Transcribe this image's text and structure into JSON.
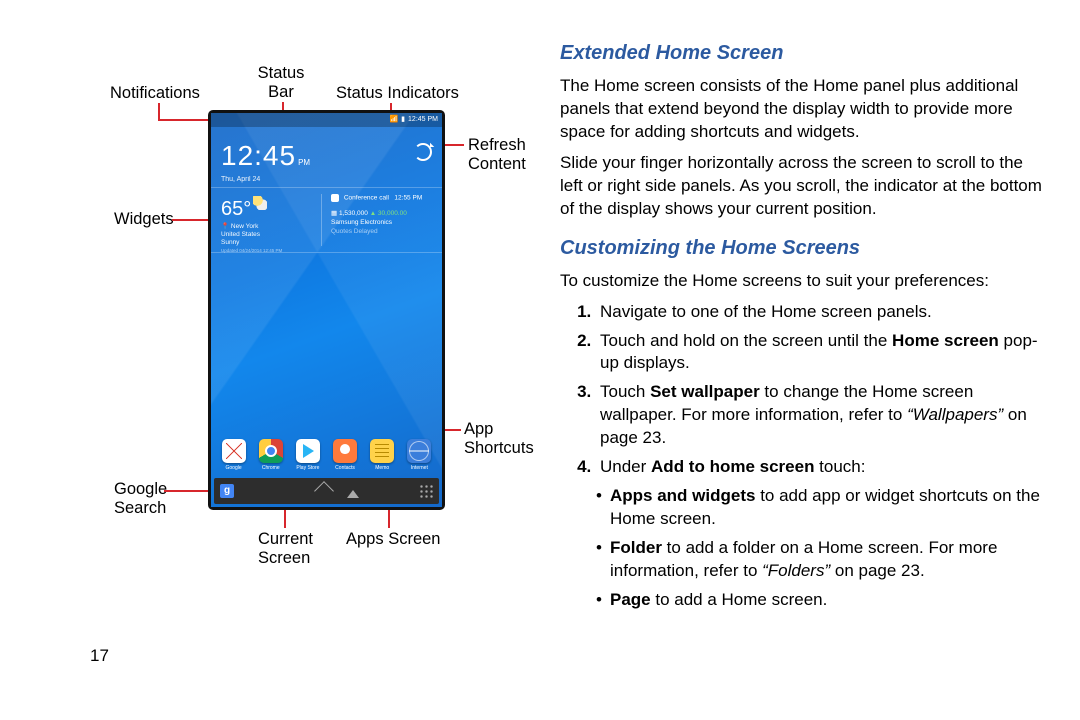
{
  "page_number": "17",
  "labels": {
    "notifications": "Notifications",
    "status_bar": "Status\nBar",
    "status_indicators": "Status Indicators",
    "refresh": "Refresh\nContent",
    "widgets": "Widgets",
    "app_shortcuts": "App\nShortcuts",
    "google_search": "Google\nSearch",
    "current_screen": "Current\nScreen",
    "apps_screen": "Apps Screen"
  },
  "device": {
    "status_time": "12:45 PM",
    "clock_time": "12:45",
    "clock_ampm": "PM",
    "clock_date": "Thu, April 24",
    "weather": {
      "temp": "65°",
      "city": "New York",
      "region": "United States",
      "cond": "Sunny",
      "updated": "Updated 04/24/2014 12:45 PM"
    },
    "calendar": {
      "title": "Conference call",
      "time": "12:55 PM"
    },
    "stock": {
      "symbol": "Samsung Electronics",
      "price": "1,530,000",
      "change": "▲ 30,000.00",
      "note": "Quotes Delayed"
    },
    "apps": [
      {
        "name": "Google",
        "cls": "gmail"
      },
      {
        "name": "Chrome",
        "cls": "chrome"
      },
      {
        "name": "Play Store",
        "cls": "play"
      },
      {
        "name": "Contacts",
        "cls": "contacts"
      },
      {
        "name": "Memo",
        "cls": "memo"
      },
      {
        "name": "Internet",
        "cls": "internet"
      }
    ]
  },
  "right": {
    "h1": "Extended Home Screen",
    "p1": "The Home screen consists of the Home panel plus additional panels that extend beyond the display width to provide more space for adding shortcuts and widgets.",
    "p2": "Slide your finger horizontally across the screen to scroll to the left or right side panels. As you scroll, the indicator at the bottom of the display shows your current position.",
    "h2": "Customizing the Home Screens",
    "intro": "To customize the Home screens to suit your preferences:",
    "steps": {
      "s1": "Navigate to one of the Home screen panels.",
      "s2a": "Touch and hold on the screen until the ",
      "s2b": "Home screen",
      "s2c": " pop-up displays.",
      "s3a": "Touch ",
      "s3b": "Set wallpaper",
      "s3c": " to change the Home screen wallpaper. For more information, refer to ",
      "s3ref": "“Wallpapers”",
      "s3d": " on page 23.",
      "s4a": "Under ",
      "s4b": "Add to home screen",
      "s4c": " touch:"
    },
    "bullets": {
      "b1a": "Apps and widgets",
      "b1b": " to add app or widget shortcuts on the Home screen.",
      "b2a": "Folder",
      "b2b": " to add a folder on a Home screen. For more information, refer to ",
      "b2ref": "“Folders”",
      "b2c": " on page 23.",
      "b3a": "Page",
      "b3b": " to add a Home screen."
    }
  }
}
